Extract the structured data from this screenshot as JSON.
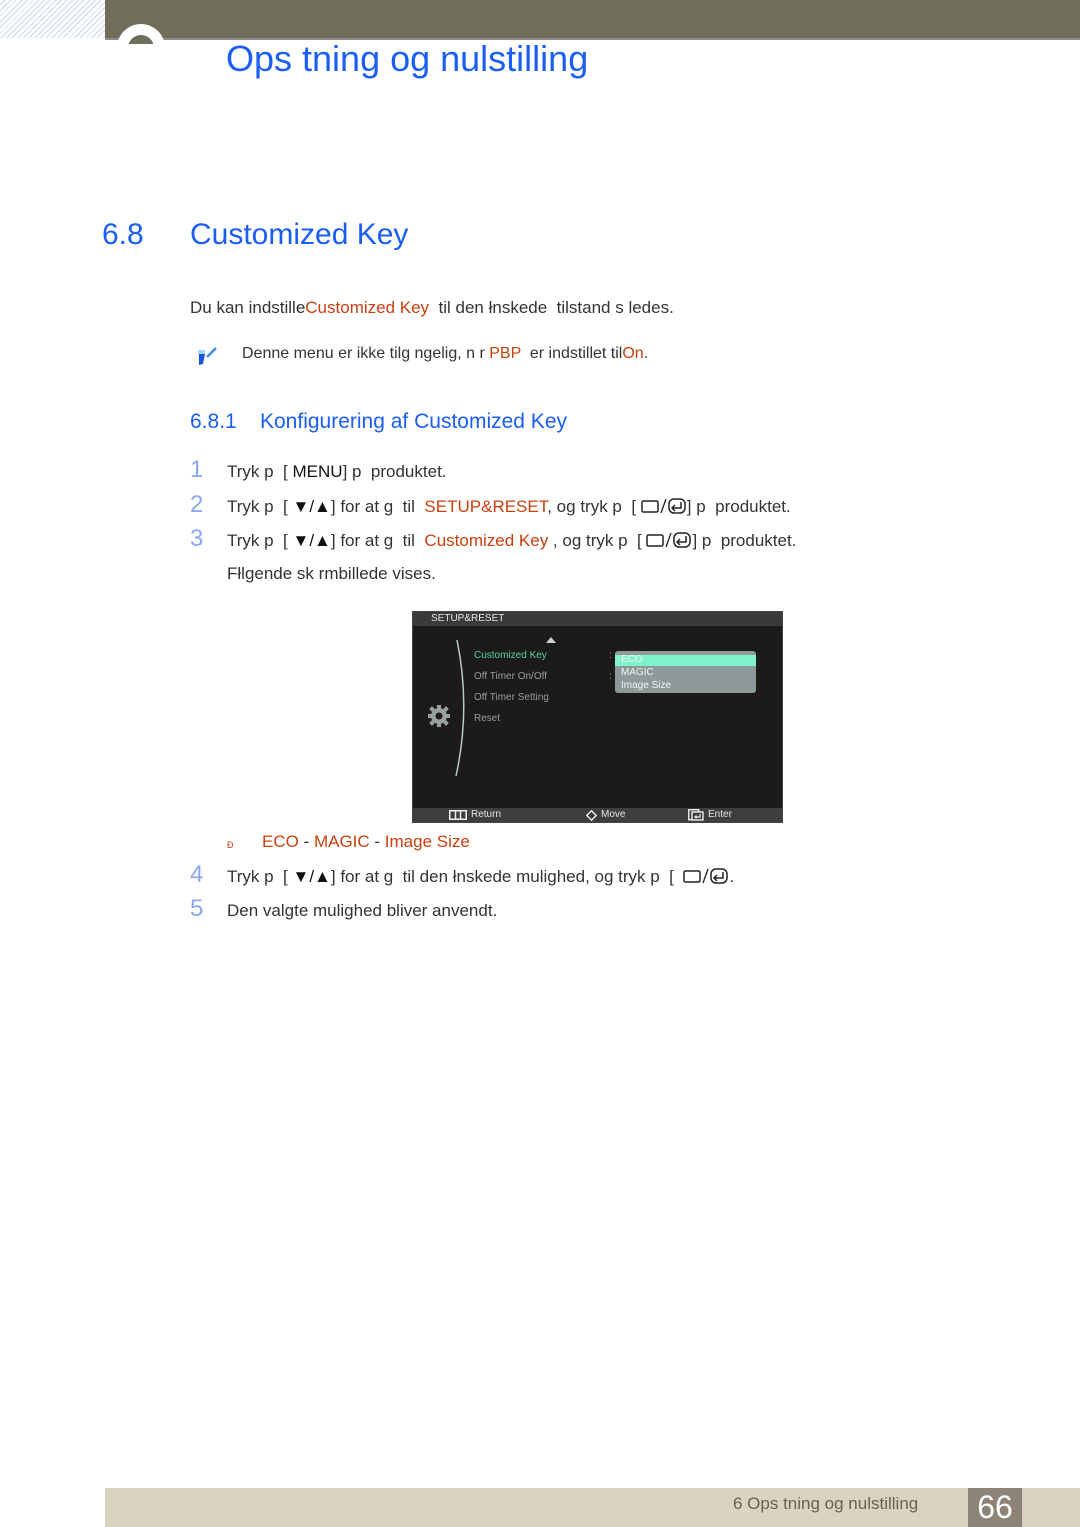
{
  "header": {
    "chapter_title": "Ops tning og nulstilling"
  },
  "section": {
    "number": "6.8",
    "title": "Customized Key",
    "intro": {
      "before": "Du kan indstille",
      "highlight": "Customized Key",
      "after": "  til den łnskede  tilstand s ledes."
    },
    "note": {
      "icon": "note-pencil-icon",
      "before": "Denne menu er ikke tilg ngelig, n r ",
      "highlight1": "PBP",
      "middle": "  er indstillet til",
      "highlight2": "On",
      "after": "."
    }
  },
  "subsection": {
    "number": "6.8.1",
    "title": "Konfigurering af Customized Key"
  },
  "steps": [
    {
      "num": "1",
      "t1": "Tryk p  [ ",
      "key": "MENU",
      "t2": "] p  produktet."
    },
    {
      "num": "2",
      "t1": "Tryk p  [ ",
      "key": "▼/▲",
      "t2": "] for at g  til  ",
      "highlight": "SETUP&RESET",
      "t3": ", og tryk p  [ ",
      "t4": "] p  produktet."
    },
    {
      "num": "3",
      "t1": "Tryk p  [ ",
      "key": "▼/▲",
      "t2": "] for at g  til  ",
      "highlight": "Customized Key",
      "t3": " , og tryk p  [ ",
      "t4": "] p  produktet.",
      "followup": "Fłlgende sk rmbillede vises."
    },
    {
      "num": "4",
      "t1": "Tryk p  [ ",
      "key": "▼/▲",
      "t2": "] for at g  til den łnskede mulighed, og tryk p  [  ",
      "t3": "."
    },
    {
      "num": "5",
      "t1": "Den valgte mulighed bliver anvendt."
    }
  ],
  "osd": {
    "header": "SETUP&RESET",
    "menu_items": [
      {
        "label": "Customized Key",
        "active": true,
        "has_value": true
      },
      {
        "label": "Off Timer On/Off",
        "active": false,
        "has_value": true
      },
      {
        "label": "Off Timer Setting",
        "active": false,
        "has_value": false
      },
      {
        "label": "Reset",
        "active": false,
        "has_value": false
      }
    ],
    "dropdown_options": [
      "ECO",
      "MAGIC",
      "Image Size"
    ],
    "selected_option": "ECO",
    "footer": {
      "return": "Return",
      "move": "Move",
      "enter": "Enter"
    },
    "colors": {
      "active_item": "#4fd6a2",
      "selected_bar": "#7ff2cb"
    }
  },
  "options": {
    "bullet": "Ð",
    "items": [
      "ECO",
      "MAGIC",
      "Image Size"
    ],
    "separator": " - "
  },
  "footer": {
    "chapter_label": "6 Ops tning og nulstilling",
    "page_number": "66"
  },
  "colors": {
    "heading": "#1a5ef6",
    "highlight": "#c9400f",
    "step_number": "#8ba8ef",
    "top_band": "#6e6e5a",
    "footer_band": "#d9d3c1",
    "page_box": "#8d8477"
  }
}
